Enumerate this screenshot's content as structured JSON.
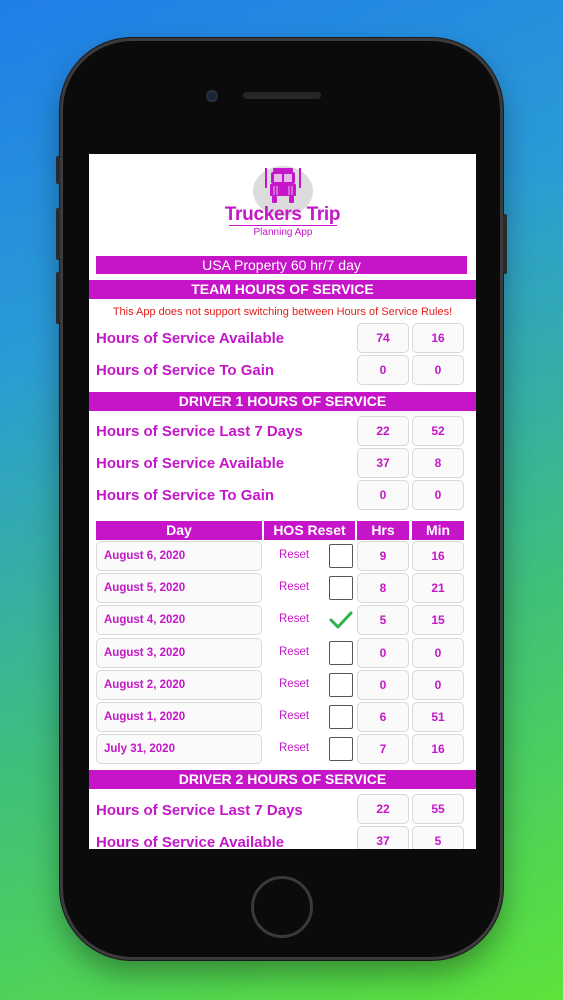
{
  "app": {
    "logo_title": "Truckers Trip",
    "logo_subtitle": "Planning App",
    "logo_icon": "truck-icon"
  },
  "rule_set": "USA Property 60 hr/7 day",
  "team": {
    "header": "TEAM HOURS OF SERVICE",
    "notice": "This App does not support switching between Hours of Service Rules!",
    "rows": [
      {
        "label": "Hours of Service Available",
        "hrs": "74",
        "min": "16"
      },
      {
        "label": "Hours of Service To Gain",
        "hrs": "0",
        "min": "0"
      }
    ]
  },
  "driver1": {
    "header": "DRIVER 1 HOURS OF SERVICE",
    "rows": [
      {
        "label": "Hours of Service Last 7 Days",
        "hrs": "22",
        "min": "52"
      },
      {
        "label": "Hours of Service Available",
        "hrs": "37",
        "min": "8"
      },
      {
        "label": "Hours of Service To Gain",
        "hrs": "0",
        "min": "0"
      }
    ]
  },
  "day_table": {
    "columns": [
      "Day",
      "HOS Reset",
      "Hrs",
      "Min"
    ],
    "reset_label": "Reset",
    "rows": [
      {
        "day": "August 6, 2020",
        "checked": false,
        "hrs": "9",
        "min": "16"
      },
      {
        "day": "August 5, 2020",
        "checked": false,
        "hrs": "8",
        "min": "21"
      },
      {
        "day": "August 4, 2020",
        "checked": true,
        "hrs": "5",
        "min": "15"
      },
      {
        "day": "August 3, 2020",
        "checked": false,
        "hrs": "0",
        "min": "0"
      },
      {
        "day": "August 2, 2020",
        "checked": false,
        "hrs": "0",
        "min": "0"
      },
      {
        "day": "August 1, 2020",
        "checked": false,
        "hrs": "6",
        "min": "51"
      },
      {
        "day": "July 31, 2020",
        "checked": false,
        "hrs": "7",
        "min": "16"
      }
    ]
  },
  "driver2": {
    "header": "DRIVER 2 HOURS OF SERVICE",
    "rows": [
      {
        "label": "Hours of Service Last 7 Days",
        "hrs": "22",
        "min": "55"
      },
      {
        "label": "Hours of Service Available",
        "hrs": "37",
        "min": "5"
      }
    ]
  },
  "colors": {
    "brand": "#c614c9",
    "notice": "#e0201c",
    "check": "#2fb24a"
  }
}
